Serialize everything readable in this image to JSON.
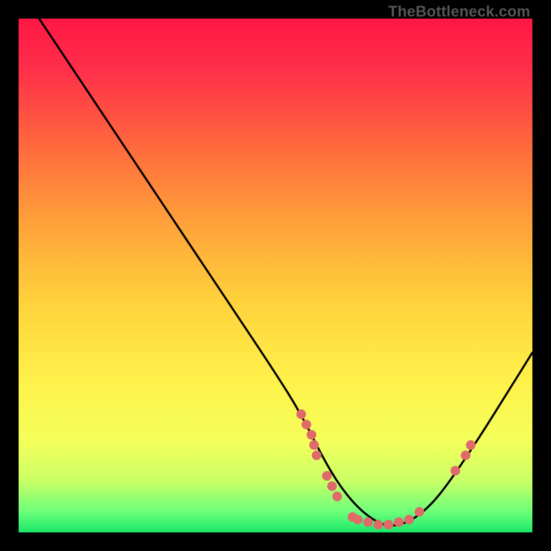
{
  "attribution": "TheBottleneck.com",
  "chart_data": {
    "type": "line",
    "title": "",
    "xlabel": "",
    "ylabel": "",
    "xlim": [
      0,
      100
    ],
    "ylim": [
      0,
      100
    ],
    "grid": false,
    "legend": false,
    "series": [
      {
        "name": "bottleneck-curve",
        "x": [
          4,
          10,
          18,
          26,
          34,
          42,
          50,
          55,
          60,
          64,
          68,
          72,
          76,
          80,
          84,
          90,
          95,
          100
        ],
        "y": [
          100,
          91,
          79,
          67,
          55,
          43,
          31,
          23,
          13,
          7,
          3,
          1,
          2,
          5,
          10,
          19,
          27,
          35
        ]
      }
    ],
    "points": [
      {
        "x": 55,
        "y": 23
      },
      {
        "x": 56,
        "y": 21
      },
      {
        "x": 57,
        "y": 19
      },
      {
        "x": 57.5,
        "y": 17
      },
      {
        "x": 58,
        "y": 15
      },
      {
        "x": 60,
        "y": 11
      },
      {
        "x": 61,
        "y": 9
      },
      {
        "x": 62,
        "y": 7
      },
      {
        "x": 65,
        "y": 3
      },
      {
        "x": 66,
        "y": 2.5
      },
      {
        "x": 68,
        "y": 2
      },
      {
        "x": 70,
        "y": 1.5
      },
      {
        "x": 72,
        "y": 1.5
      },
      {
        "x": 74,
        "y": 2
      },
      {
        "x": 76,
        "y": 2.5
      },
      {
        "x": 78,
        "y": 4
      },
      {
        "x": 85,
        "y": 12
      },
      {
        "x": 87,
        "y": 15
      },
      {
        "x": 88,
        "y": 17
      }
    ],
    "gradient_stops": [
      {
        "offset": 0.0,
        "color": "#ff1744"
      },
      {
        "offset": 0.1,
        "color": "#ff2f4a"
      },
      {
        "offset": 0.25,
        "color": "#ff6a3d"
      },
      {
        "offset": 0.4,
        "color": "#ffa23a"
      },
      {
        "offset": 0.55,
        "color": "#ffd23b"
      },
      {
        "offset": 0.7,
        "color": "#fff04a"
      },
      {
        "offset": 0.82,
        "color": "#f5ff5a"
      },
      {
        "offset": 0.9,
        "color": "#c9ff66"
      },
      {
        "offset": 0.96,
        "color": "#6cff7a"
      },
      {
        "offset": 1.0,
        "color": "#19e86a"
      }
    ],
    "curve_stroke": "#000000",
    "curve_width": 3,
    "point_fill": "#e06a6a",
    "point_radius": 7
  }
}
